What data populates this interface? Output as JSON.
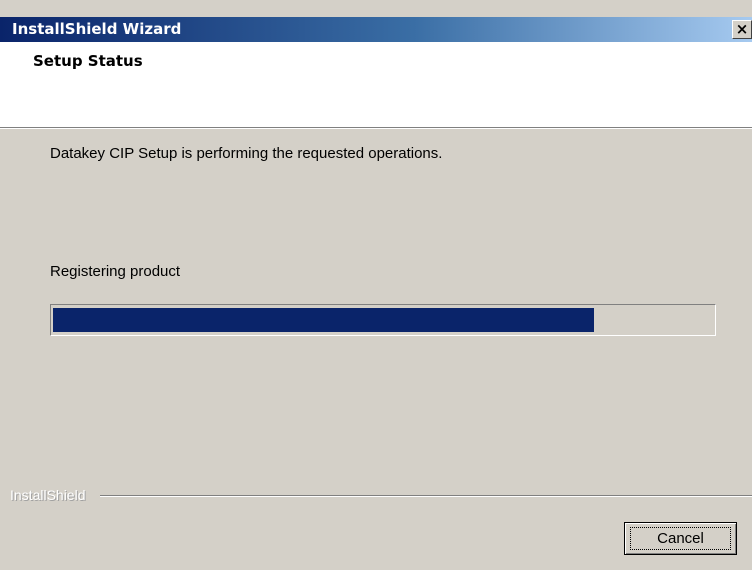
{
  "window": {
    "title": "InstallShield Wizard",
    "close_glyph": "×",
    "title_gradient": [
      "#0a246a",
      "#a6caf0"
    ],
    "body_color": "#d4d0c8"
  },
  "header": {
    "title": "Setup Status"
  },
  "main": {
    "status_message": "Datakey CIP Setup is performing the requested operations.",
    "progress_label": "Registering product",
    "progress_percent": 82,
    "progress_color": "#0a246a"
  },
  "footer": {
    "brand": "InstallShield",
    "cancel_label": "Cancel"
  }
}
